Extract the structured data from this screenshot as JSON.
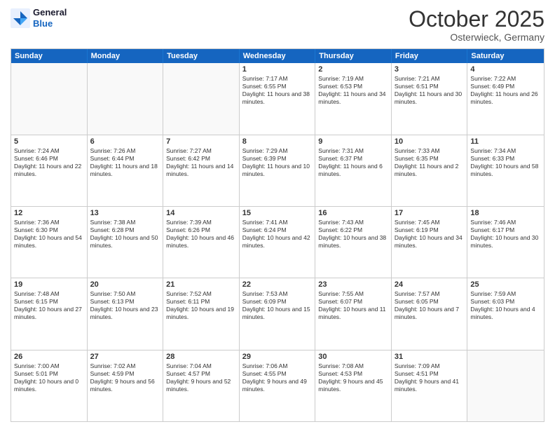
{
  "logo": {
    "line1": "General",
    "line2": "Blue"
  },
  "title": "October 2025",
  "subtitle": "Osterwieck, Germany",
  "header_days": [
    "Sunday",
    "Monday",
    "Tuesday",
    "Wednesday",
    "Thursday",
    "Friday",
    "Saturday"
  ],
  "weeks": [
    [
      {
        "day": "",
        "text": ""
      },
      {
        "day": "",
        "text": ""
      },
      {
        "day": "",
        "text": ""
      },
      {
        "day": "1",
        "text": "Sunrise: 7:17 AM\nSunset: 6:55 PM\nDaylight: 11 hours and 38 minutes."
      },
      {
        "day": "2",
        "text": "Sunrise: 7:19 AM\nSunset: 6:53 PM\nDaylight: 11 hours and 34 minutes."
      },
      {
        "day": "3",
        "text": "Sunrise: 7:21 AM\nSunset: 6:51 PM\nDaylight: 11 hours and 30 minutes."
      },
      {
        "day": "4",
        "text": "Sunrise: 7:22 AM\nSunset: 6:49 PM\nDaylight: 11 hours and 26 minutes."
      }
    ],
    [
      {
        "day": "5",
        "text": "Sunrise: 7:24 AM\nSunset: 6:46 PM\nDaylight: 11 hours and 22 minutes."
      },
      {
        "day": "6",
        "text": "Sunrise: 7:26 AM\nSunset: 6:44 PM\nDaylight: 11 hours and 18 minutes."
      },
      {
        "day": "7",
        "text": "Sunrise: 7:27 AM\nSunset: 6:42 PM\nDaylight: 11 hours and 14 minutes."
      },
      {
        "day": "8",
        "text": "Sunrise: 7:29 AM\nSunset: 6:39 PM\nDaylight: 11 hours and 10 minutes."
      },
      {
        "day": "9",
        "text": "Sunrise: 7:31 AM\nSunset: 6:37 PM\nDaylight: 11 hours and 6 minutes."
      },
      {
        "day": "10",
        "text": "Sunrise: 7:33 AM\nSunset: 6:35 PM\nDaylight: 11 hours and 2 minutes."
      },
      {
        "day": "11",
        "text": "Sunrise: 7:34 AM\nSunset: 6:33 PM\nDaylight: 10 hours and 58 minutes."
      }
    ],
    [
      {
        "day": "12",
        "text": "Sunrise: 7:36 AM\nSunset: 6:30 PM\nDaylight: 10 hours and 54 minutes."
      },
      {
        "day": "13",
        "text": "Sunrise: 7:38 AM\nSunset: 6:28 PM\nDaylight: 10 hours and 50 minutes."
      },
      {
        "day": "14",
        "text": "Sunrise: 7:39 AM\nSunset: 6:26 PM\nDaylight: 10 hours and 46 minutes."
      },
      {
        "day": "15",
        "text": "Sunrise: 7:41 AM\nSunset: 6:24 PM\nDaylight: 10 hours and 42 minutes."
      },
      {
        "day": "16",
        "text": "Sunrise: 7:43 AM\nSunset: 6:22 PM\nDaylight: 10 hours and 38 minutes."
      },
      {
        "day": "17",
        "text": "Sunrise: 7:45 AM\nSunset: 6:19 PM\nDaylight: 10 hours and 34 minutes."
      },
      {
        "day": "18",
        "text": "Sunrise: 7:46 AM\nSunset: 6:17 PM\nDaylight: 10 hours and 30 minutes."
      }
    ],
    [
      {
        "day": "19",
        "text": "Sunrise: 7:48 AM\nSunset: 6:15 PM\nDaylight: 10 hours and 27 minutes."
      },
      {
        "day": "20",
        "text": "Sunrise: 7:50 AM\nSunset: 6:13 PM\nDaylight: 10 hours and 23 minutes."
      },
      {
        "day": "21",
        "text": "Sunrise: 7:52 AM\nSunset: 6:11 PM\nDaylight: 10 hours and 19 minutes."
      },
      {
        "day": "22",
        "text": "Sunrise: 7:53 AM\nSunset: 6:09 PM\nDaylight: 10 hours and 15 minutes."
      },
      {
        "day": "23",
        "text": "Sunrise: 7:55 AM\nSunset: 6:07 PM\nDaylight: 10 hours and 11 minutes."
      },
      {
        "day": "24",
        "text": "Sunrise: 7:57 AM\nSunset: 6:05 PM\nDaylight: 10 hours and 7 minutes."
      },
      {
        "day": "25",
        "text": "Sunrise: 7:59 AM\nSunset: 6:03 PM\nDaylight: 10 hours and 4 minutes."
      }
    ],
    [
      {
        "day": "26",
        "text": "Sunrise: 7:00 AM\nSunset: 5:01 PM\nDaylight: 10 hours and 0 minutes."
      },
      {
        "day": "27",
        "text": "Sunrise: 7:02 AM\nSunset: 4:59 PM\nDaylight: 9 hours and 56 minutes."
      },
      {
        "day": "28",
        "text": "Sunrise: 7:04 AM\nSunset: 4:57 PM\nDaylight: 9 hours and 52 minutes."
      },
      {
        "day": "29",
        "text": "Sunrise: 7:06 AM\nSunset: 4:55 PM\nDaylight: 9 hours and 49 minutes."
      },
      {
        "day": "30",
        "text": "Sunrise: 7:08 AM\nSunset: 4:53 PM\nDaylight: 9 hours and 45 minutes."
      },
      {
        "day": "31",
        "text": "Sunrise: 7:09 AM\nSunset: 4:51 PM\nDaylight: 9 hours and 41 minutes."
      },
      {
        "day": "",
        "text": ""
      }
    ]
  ]
}
